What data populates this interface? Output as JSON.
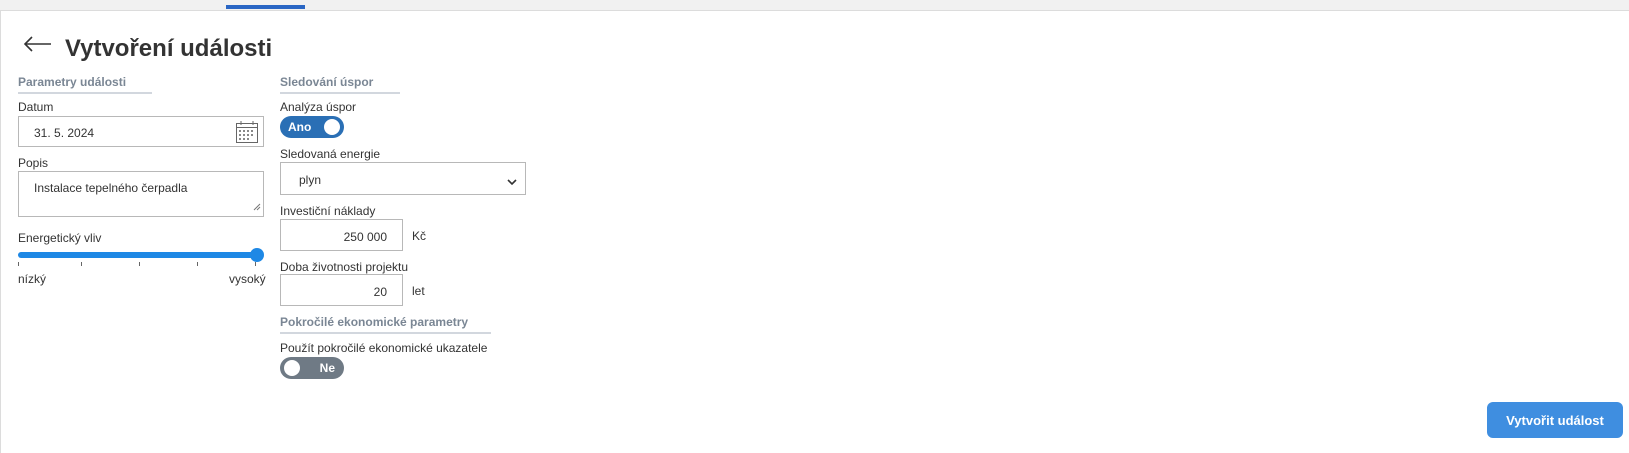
{
  "page": {
    "title": "Vytvoření události"
  },
  "left": {
    "heading": "Parametry události",
    "date": {
      "label": "Datum",
      "value": "31. 5. 2024",
      "icon": "calendar-icon"
    },
    "description": {
      "label": "Popis",
      "value": "Instalace tepelného čerpadla"
    },
    "energy_impact": {
      "label": "Energetický vliv",
      "min_label": "nízký",
      "max_label": "vysoký",
      "level": 1.0
    }
  },
  "right": {
    "heading": "Sledování úspor",
    "savings_analysis": {
      "label": "Analýza úspor",
      "toggle_text": "Ano"
    },
    "tracked_energy": {
      "label": "Sledovaná energie",
      "value": "plyn"
    },
    "investment": {
      "label": "Investiční náklady",
      "value": "250 000",
      "unit": "Kč"
    },
    "lifetime": {
      "label": "Doba životnosti projektu",
      "value": "20",
      "unit": "let"
    },
    "advanced_heading": "Pokročilé ekonomické parametry",
    "advanced": {
      "label": "Použít pokročilé ekonomické ukazatele",
      "toggle_text": "Ne"
    }
  },
  "actions": {
    "create_label": "Vytvořit událost"
  },
  "colors": {
    "accent": "#2a66c4",
    "toggle_on": "#2a6fb5",
    "toggle_off": "#6f7a85",
    "button": "#3f8ee0",
    "slider": "#1e88e5"
  }
}
